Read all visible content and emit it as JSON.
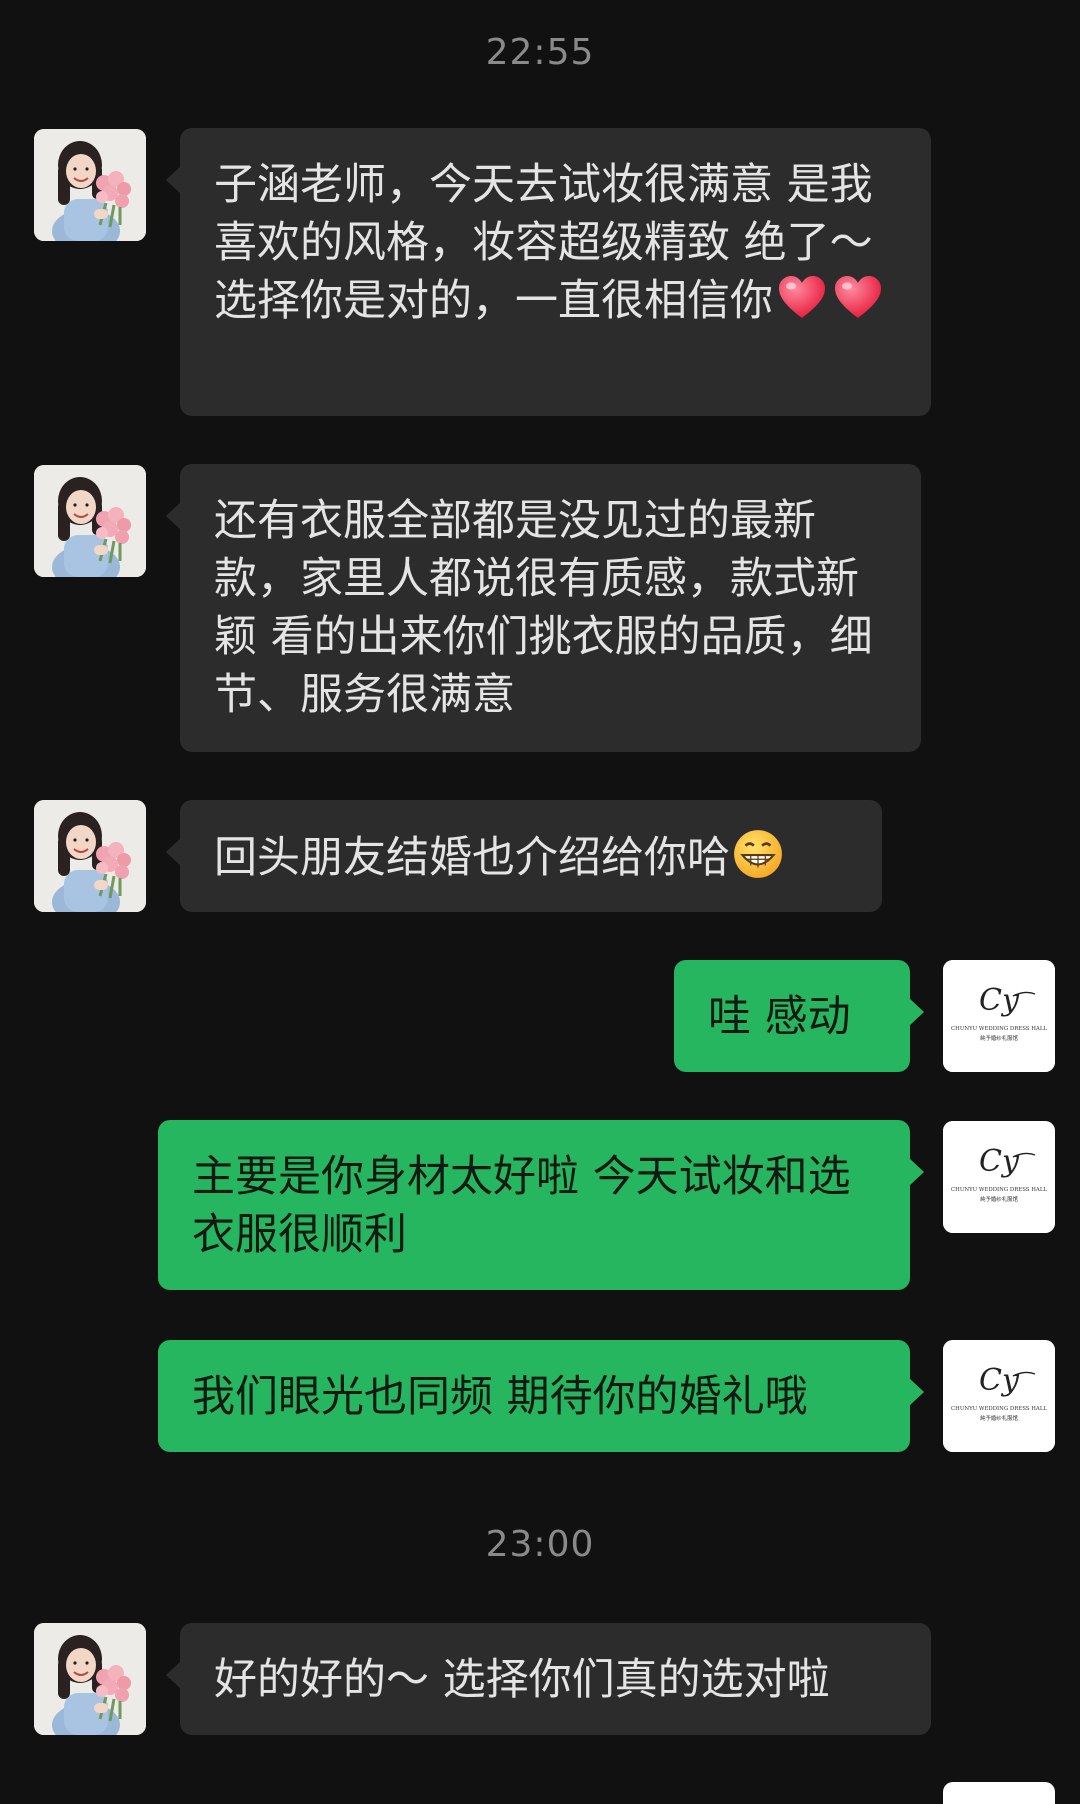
{
  "timestamps": [
    "22:55",
    "23:00"
  ],
  "contact_avatar": {
    "icon": "contact-photo-avatar"
  },
  "shop_avatar": {
    "icon": "shop-logo-avatar",
    "logo_mark": "Cy",
    "brand_name": "CHUNYU WEDDING DRESS HALL",
    "brand_name_cn": "純予婚纱礼服馆"
  },
  "messages": [
    {
      "side": "in",
      "text": "子涵老师，今天去试妆很满意 是我喜欢的风格，妆容超级精致 绝了～选择你是对的，一直很相信你",
      "emoji": "heart-emoji x2"
    },
    {
      "side": "in",
      "text": "还有衣服全部都是没见过的最新款，家里人都说很有质感，款式新颖 看的出来你们挑衣服的品质，细节、服务很满意"
    },
    {
      "side": "in",
      "text": "回头朋友结婚也介绍给你哈",
      "emoji": "grinning-emoji"
    },
    {
      "side": "out",
      "text": "哇 感动"
    },
    {
      "side": "out",
      "text": "主要是你身材太好啦 今天试妆和选衣服很顺利"
    },
    {
      "side": "out",
      "text": "我们眼光也同频 期待你的婚礼哦"
    },
    {
      "side": "in",
      "text": "好的好的～ 选择你们真的选对啦"
    }
  ],
  "colors": {
    "background": "#111111",
    "incoming_bubble": "#2c2c2c",
    "outgoing_bubble": "#27b660",
    "timestamp_text": "#8a8a8a"
  }
}
